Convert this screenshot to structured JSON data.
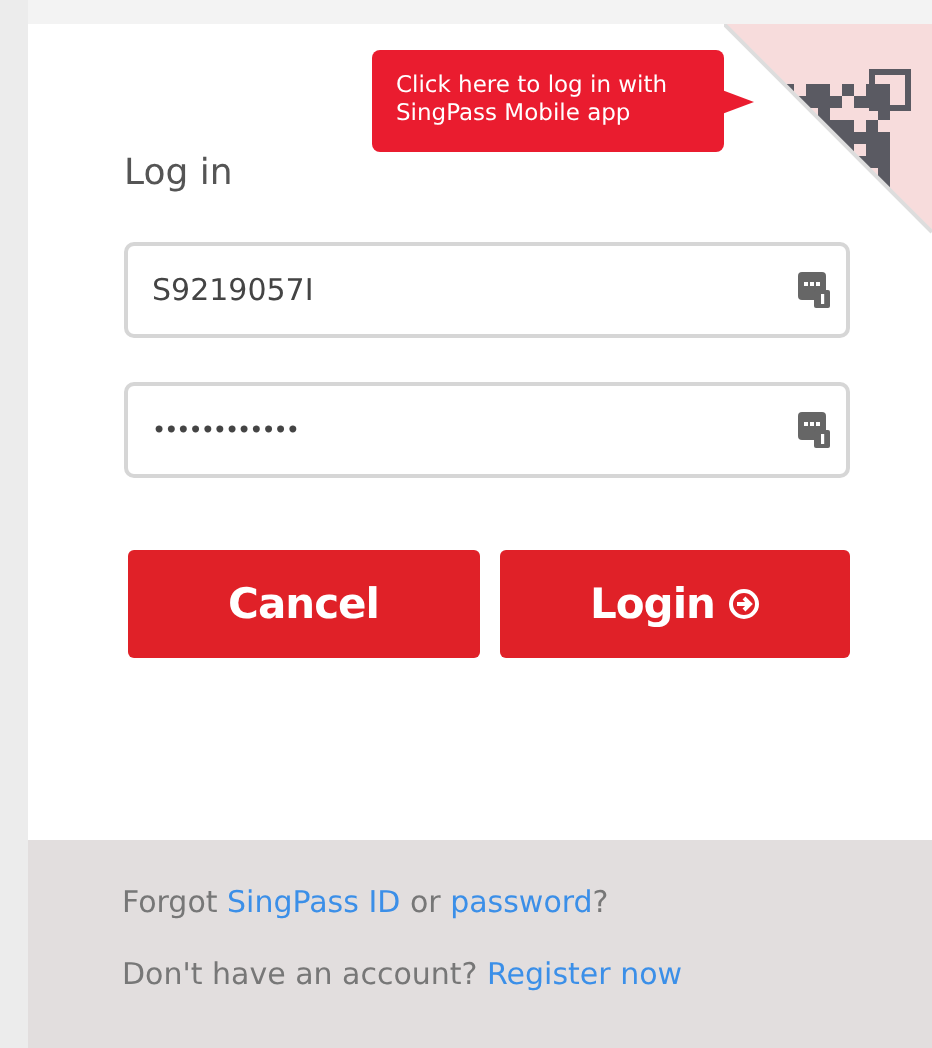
{
  "tooltip": {
    "text": "Click here to log in with SingPass Mobile app"
  },
  "heading": "Log in",
  "fields": [
    {
      "kind": "id",
      "value": "S9219057I"
    },
    {
      "kind": "password",
      "value": "••••••••••••"
    }
  ],
  "buttons": [
    {
      "kind": "cancel",
      "label": "Cancel"
    },
    {
      "kind": "login",
      "label": "Login"
    }
  ],
  "footer": [
    [
      {
        "kind": "text",
        "text": "Forgot "
      },
      {
        "kind": "link",
        "text": "SingPass ID"
      },
      {
        "kind": "text",
        "text": " or "
      },
      {
        "kind": "link",
        "text": "password"
      },
      {
        "kind": "text",
        "text": "?"
      }
    ],
    [
      {
        "kind": "text",
        "text": "Don't have an account? "
      },
      {
        "kind": "link",
        "text": "Register now"
      }
    ]
  ]
}
